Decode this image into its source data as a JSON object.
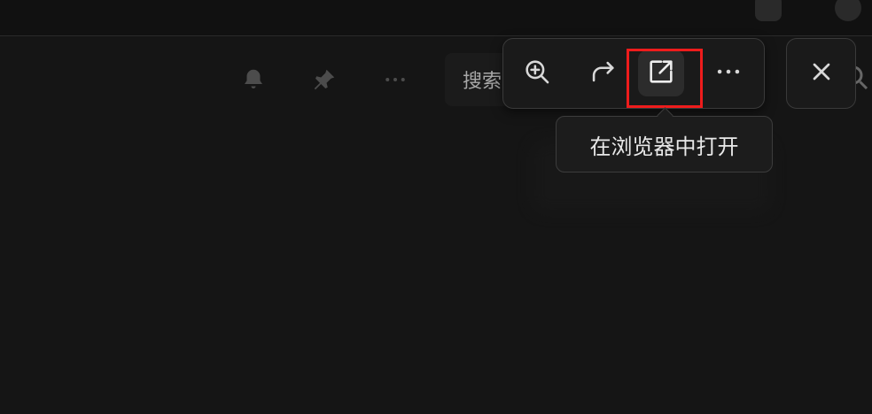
{
  "background_ui": {
    "search_placeholder": "搜索"
  },
  "toolbar": {
    "buttons": [
      {
        "icon": "zoom-in-icon"
      },
      {
        "icon": "share-arrow-icon"
      },
      {
        "icon": "open-external-icon",
        "active": true
      },
      {
        "icon": "more-horizontal-icon"
      }
    ]
  },
  "tooltip": {
    "text": "在浏览器中打开"
  },
  "colors": {
    "highlight": "#ee1c1c",
    "background": "#151515",
    "panel": "#1a1a1a"
  }
}
